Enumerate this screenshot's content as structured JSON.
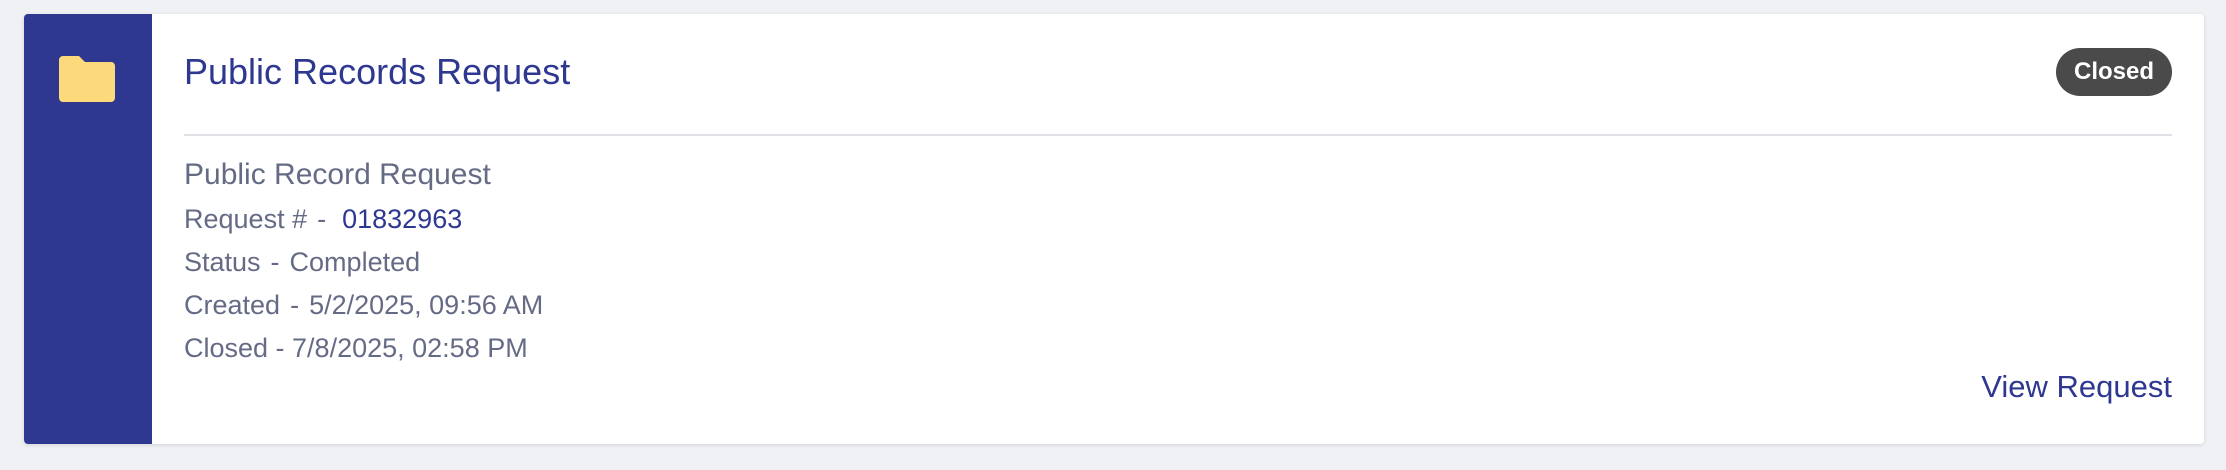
{
  "card": {
    "title": "Public Records Request",
    "badge": "Closed",
    "type": "Public Record Request",
    "request_number_label": "Request #",
    "request_number": "01832963",
    "status_label": "Status",
    "status_value": "Completed",
    "created_label": "Created",
    "created_value": "5/2/2025, 09:56 AM",
    "closed_text": "Closed - 7/8/2025, 02:58 PM",
    "separator": "-",
    "view_link": "View Request"
  },
  "colors": {
    "accent": "#2e3890",
    "folder": "#fcd97a",
    "badge_bg": "#4a4a4a",
    "muted_text": "#656b85",
    "page_bg": "#eff1f5"
  },
  "icons": {
    "side": "folder-icon"
  }
}
